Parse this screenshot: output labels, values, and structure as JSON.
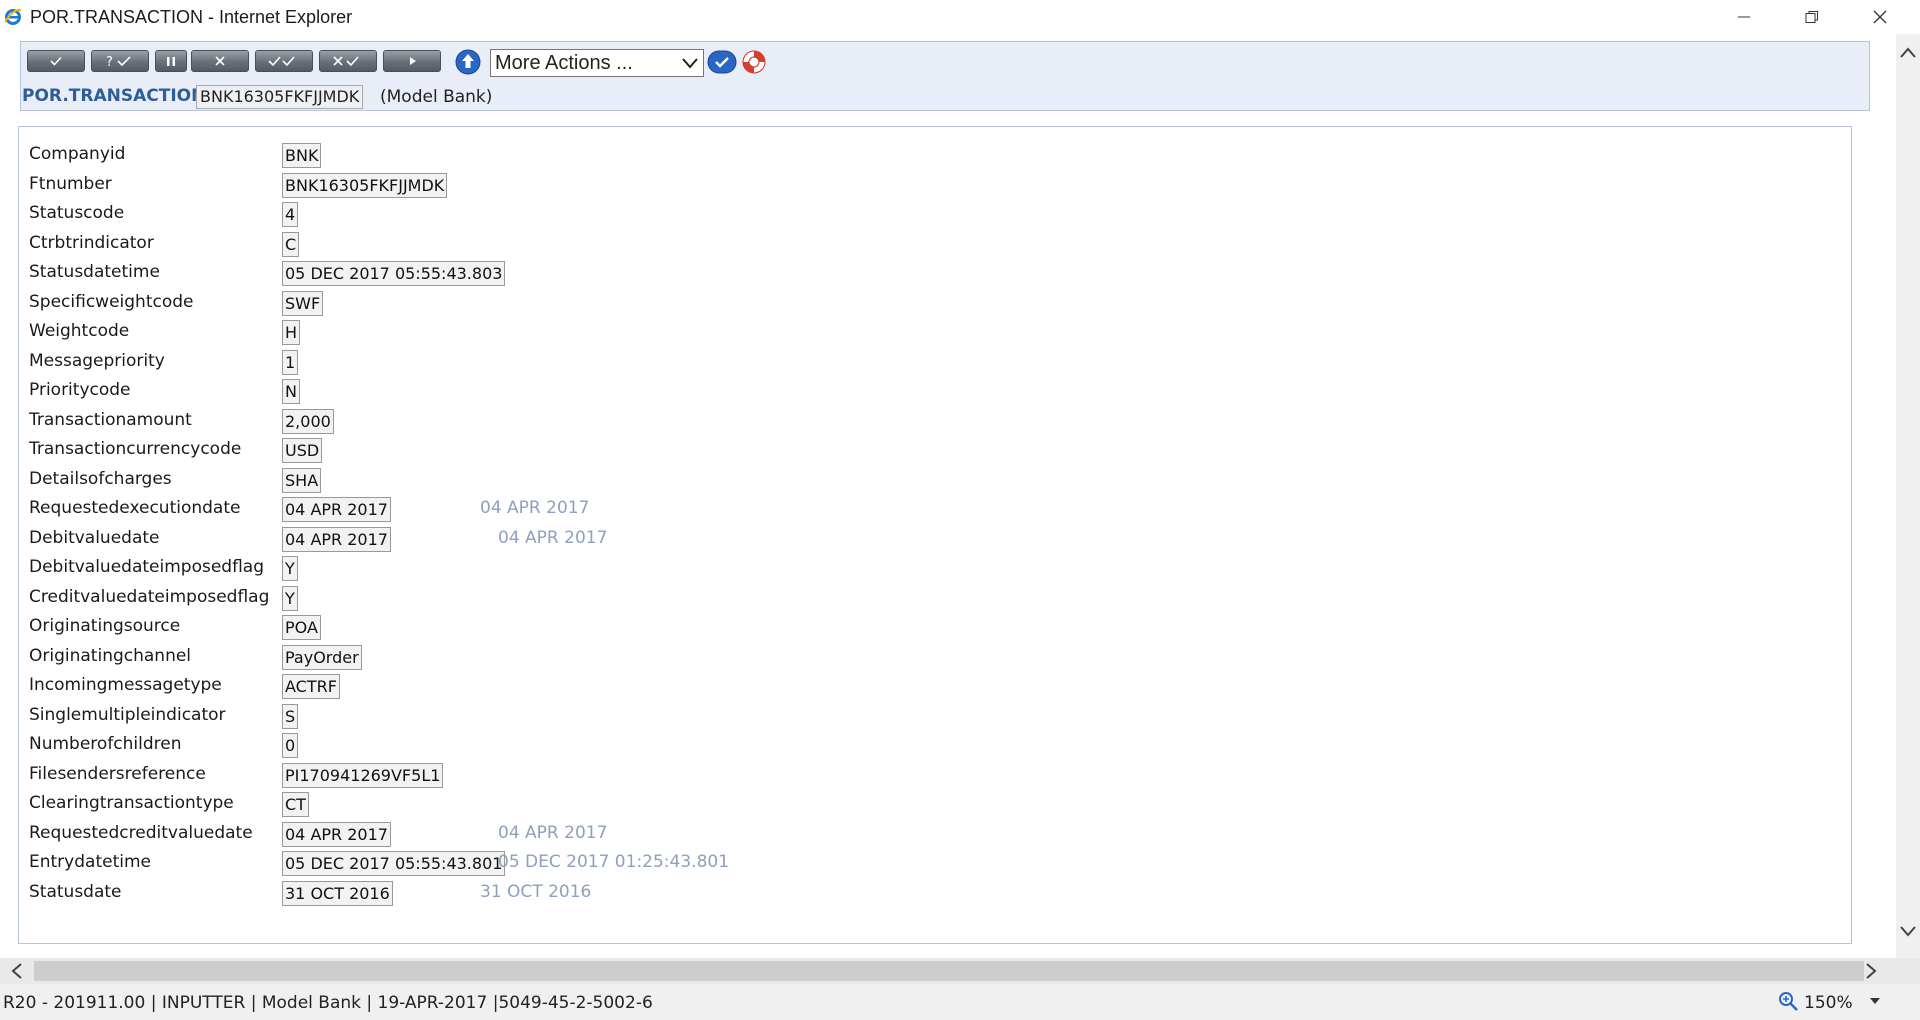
{
  "window": {
    "title": "POR.TRANSACTION - Internet Explorer"
  },
  "toolbar": {
    "buttons": [
      {
        "name": "validate",
        "label": "✓"
      },
      {
        "name": "hold-validate",
        "label": "?✓"
      },
      {
        "name": "pause",
        "label": "II"
      },
      {
        "name": "delete",
        "label": "✕"
      },
      {
        "name": "authorise",
        "label": "✓✓"
      },
      {
        "name": "reverse",
        "label": "✕✓"
      },
      {
        "name": "next",
        "label": "→"
      }
    ],
    "more_actions": "More Actions ...",
    "icons": [
      "upload-icon",
      "go-icon",
      "help-icon"
    ]
  },
  "header": {
    "app_name": "POR.TRANSACTION",
    "record_id": "BNK16305FKFJJMDK",
    "company": "(Model Bank)"
  },
  "form": {
    "rows": [
      {
        "label": "Companyid",
        "value": "BNK",
        "enrichment": ""
      },
      {
        "label": "Ftnumber",
        "value": "BNK16305FKFJJMDK",
        "enrichment": ""
      },
      {
        "label": "Statuscode",
        "value": "4",
        "enrichment": ""
      },
      {
        "label": "Ctrbtrindicator",
        "value": "C",
        "enrichment": ""
      },
      {
        "label": "Statusdatetime",
        "value": "05 DEC 2017 05:55:43.803",
        "enrichment": ""
      },
      {
        "label": "Specificweightcode",
        "value": "SWF",
        "enrichment": ""
      },
      {
        "label": "Weightcode",
        "value": "H",
        "enrichment": ""
      },
      {
        "label": "Messagepriority",
        "value": "1",
        "enrichment": ""
      },
      {
        "label": "Prioritycode",
        "value": "N",
        "enrichment": ""
      },
      {
        "label": "Transactionamount",
        "value": "2,000",
        "enrichment": ""
      },
      {
        "label": "Transactioncurrencycode",
        "value": "USD",
        "enrichment": ""
      },
      {
        "label": "Detailsofcharges",
        "value": "SHA",
        "enrichment": ""
      },
      {
        "label": "Requestedexecutiondate",
        "value": "04 APR 2017",
        "enrichment": "04 APR 2017"
      },
      {
        "label": "Debitvaluedate",
        "value": "04 APR 2017",
        "enrichment": "04 APR 2017"
      },
      {
        "label": "Debitvaluedateimposedflag",
        "value": "Y",
        "enrichment": ""
      },
      {
        "label": "Creditvaluedateimposedflag",
        "value": "Y",
        "enrichment": ""
      },
      {
        "label": "Originatingsource",
        "value": "POA",
        "enrichment": ""
      },
      {
        "label": "Originatingchannel",
        "value": "PayOrder",
        "enrichment": ""
      },
      {
        "label": "Incomingmessagetype",
        "value": "ACTRF",
        "enrichment": ""
      },
      {
        "label": "Singlemultipleindicator",
        "value": "S",
        "enrichment": ""
      },
      {
        "label": "Numberofchildren",
        "value": "0",
        "enrichment": ""
      },
      {
        "label": "Filesendersreference",
        "value": "PI170941269VF5L1",
        "enrichment": ""
      },
      {
        "label": "Clearingtransactiontype",
        "value": "CT",
        "enrichment": ""
      },
      {
        "label": "Requestedcreditvaluedate",
        "value": "04 APR 2017",
        "enrichment": "04 APR 2017"
      },
      {
        "label": "Entrydatetime",
        "value": "05 DEC 2017 05:55:43.801",
        "enrichment": "05 DEC 2017 01:25:43.801"
      },
      {
        "label": "Statusdate",
        "value": "31 OCT 2016",
        "enrichment": "31 OCT 2016"
      }
    ]
  },
  "statusbar": {
    "text": "R20 - 201911.00 | INPUTTER | Model Bank | 19-APR-2017 |5049-45-2-5002-6",
    "zoom": "150%"
  },
  "colors": {
    "accent": "#2d5e97",
    "enrichment": "#8ea0be",
    "panel_bg": "#e9edf8"
  }
}
